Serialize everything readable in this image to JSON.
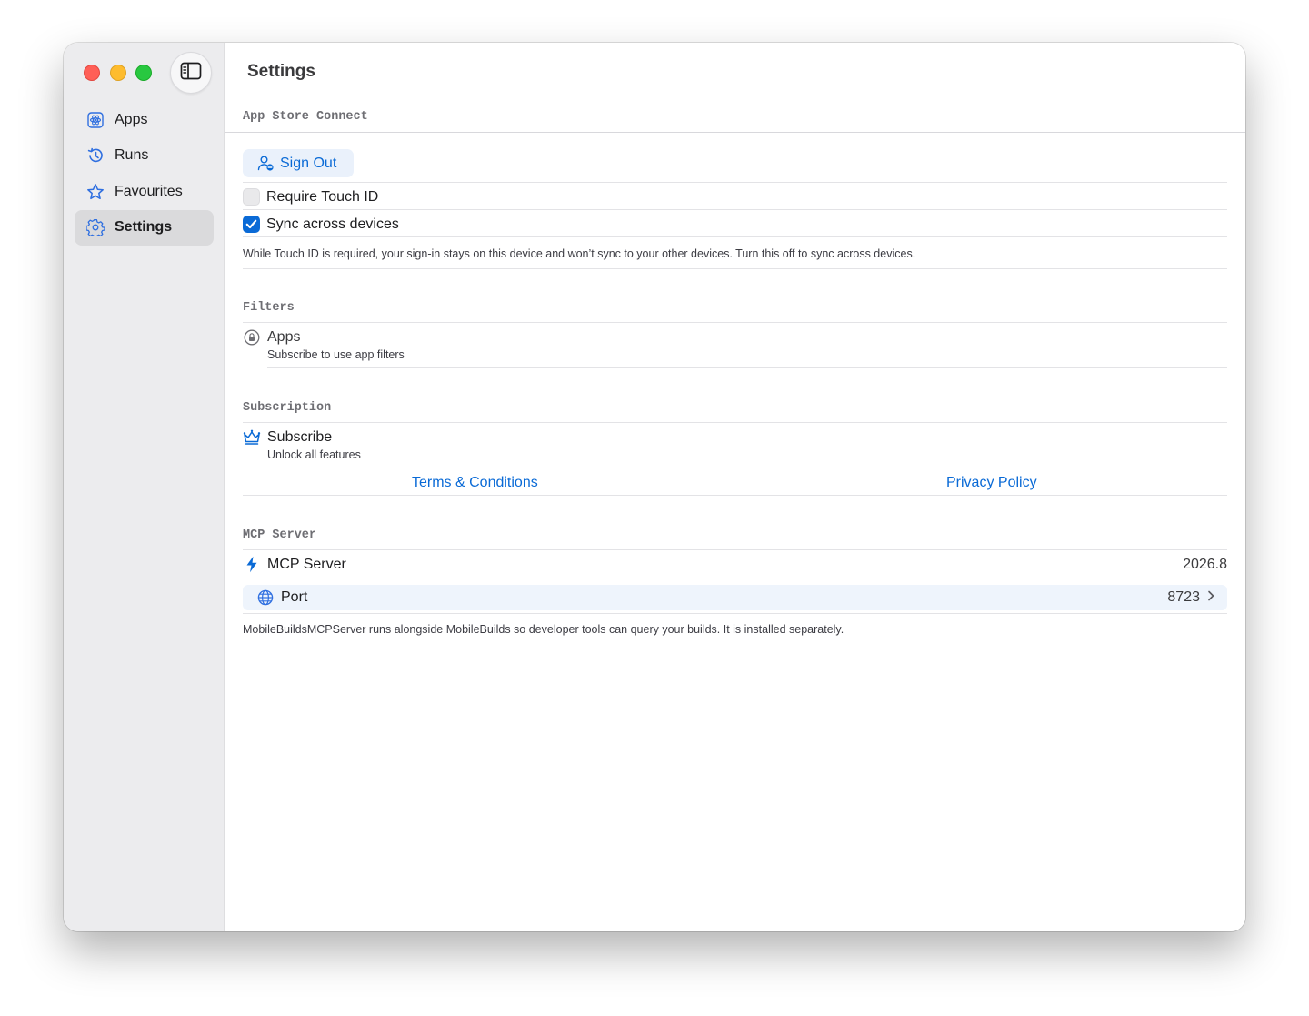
{
  "window": {
    "title": "Settings"
  },
  "sidebar": {
    "items": [
      {
        "label": "Apps",
        "icon": "atom-icon",
        "active": false
      },
      {
        "label": "Runs",
        "icon": "history-icon",
        "active": false
      },
      {
        "label": "Favourites",
        "icon": "star-icon",
        "active": false
      },
      {
        "label": "Settings",
        "icon": "gear-icon",
        "active": true
      }
    ]
  },
  "sections": {
    "app_store_connect": {
      "header": "App Store Connect",
      "sign_out_label": "Sign Out",
      "require_touch_id": {
        "label": "Require Touch ID",
        "checked": false
      },
      "sync_devices": {
        "label": "Sync across devices",
        "checked": true
      },
      "footnote": "While Touch ID is required, your sign-in stays on this device and won’t sync to your other devices. Turn this off to sync across devices."
    },
    "filters": {
      "header": "Filters",
      "apps_title": "Apps",
      "apps_subtitle": "Subscribe to use app filters"
    },
    "subscription": {
      "header": "Subscription",
      "subscribe_title": "Subscribe",
      "subscribe_subtitle": "Unlock all features",
      "terms_link": "Terms & Conditions",
      "privacy_link": "Privacy Policy"
    },
    "mcp": {
      "header": "MCP Server",
      "server_label": "MCP Server",
      "server_version": "2026.8",
      "port_label": "Port",
      "port_value": "8723",
      "footnote": "MobileBuildsMCPServer runs alongside MobileBuilds so developer tools can query your builds. It is installed separately."
    }
  },
  "colors": {
    "accent": "#0a6ad6",
    "sidebar_bg": "#ececee",
    "traffic_red": "#ff5f57",
    "traffic_yellow": "#febc2e",
    "traffic_green": "#28c840"
  }
}
